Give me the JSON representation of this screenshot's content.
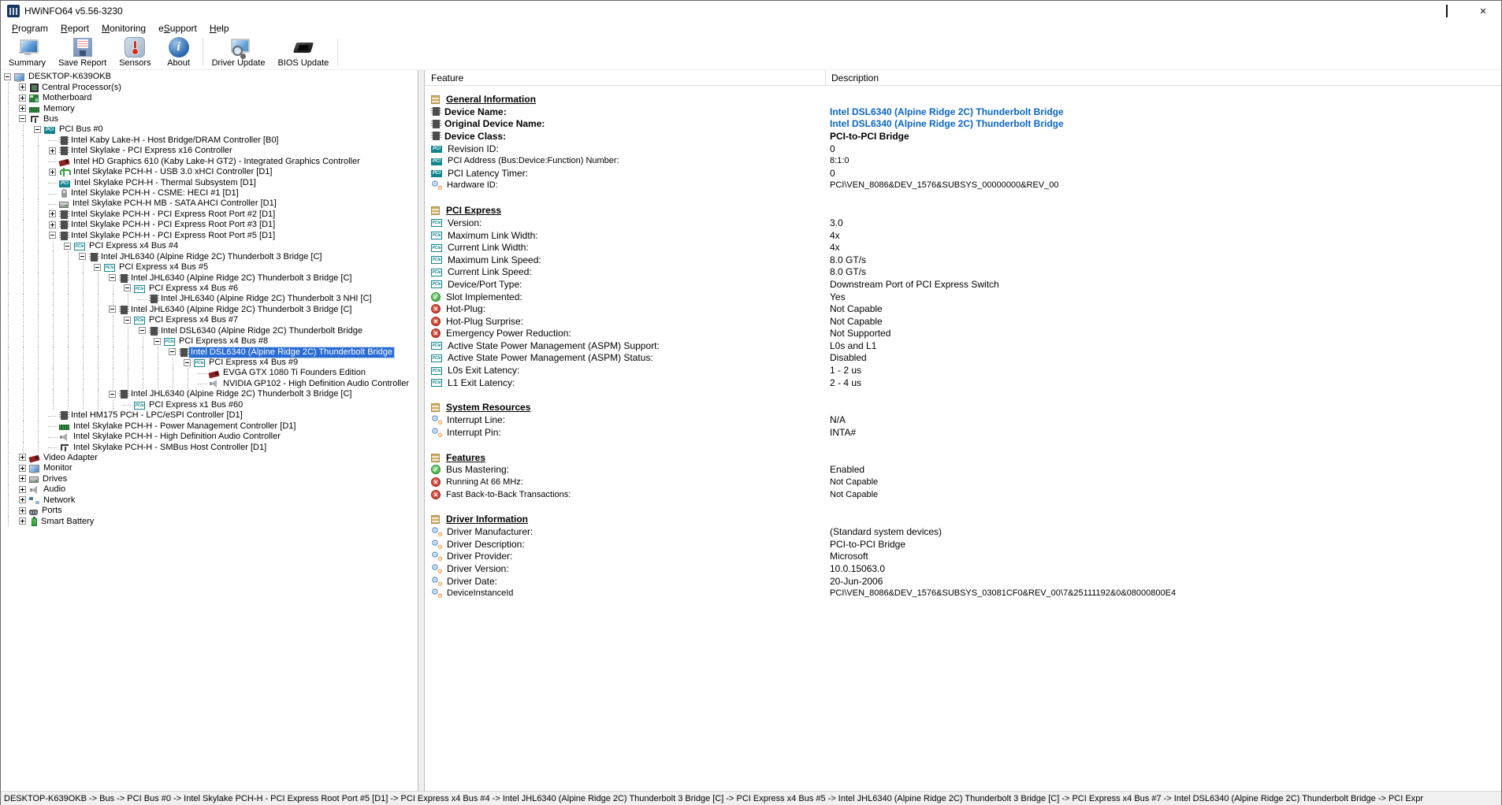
{
  "window": {
    "title": "HWiNFO64 v5.56-3230",
    "app_icon": "hwinfo-logo-icon",
    "controls": [
      {
        "id": "minimize",
        "icon": "minimize-icon"
      },
      {
        "id": "maximize",
        "icon": "maximize-icon"
      },
      {
        "id": "close",
        "icon": "close-icon"
      }
    ]
  },
  "menu": {
    "items": [
      {
        "label": "Program",
        "u": 0
      },
      {
        "label": "Report",
        "u": 0
      },
      {
        "label": "Monitoring",
        "u": 0
      },
      {
        "label": "eSupport",
        "u": 1
      },
      {
        "label": "Help",
        "u": 0
      }
    ]
  },
  "toolbar": {
    "buttons": [
      {
        "id": "summary",
        "label": "Summary",
        "icon": "summary-icon"
      },
      {
        "id": "save",
        "label": "Save Report",
        "icon": "save-report-icon"
      },
      {
        "id": "sensors",
        "label": "Sensors",
        "icon": "sensors-icon"
      },
      {
        "id": "about",
        "label": "About",
        "icon": "about-icon"
      },
      {
        "type": "separator"
      },
      {
        "id": "driver",
        "label": "Driver Update",
        "icon": "driver-update-icon"
      },
      {
        "id": "bios",
        "label": "BIOS Update",
        "icon": "bios-update-icon"
      },
      {
        "type": "separator"
      }
    ]
  },
  "tree": {
    "items": [
      {
        "level": 0,
        "expander": "minus",
        "icon": "computer-icon",
        "label": "DESKTOP-K639OKB"
      },
      {
        "level": 1,
        "expander": "plus",
        "icon": "cpu-icon",
        "label": "Central Processor(s)"
      },
      {
        "level": 1,
        "expander": "plus",
        "icon": "motherboard-icon",
        "label": "Motherboard"
      },
      {
        "level": 1,
        "expander": "plus",
        "icon": "memory-icon",
        "label": "Memory"
      },
      {
        "level": 1,
        "expander": "minus",
        "icon": "bus-icon",
        "label": "Bus"
      },
      {
        "level": 2,
        "expander": "minus",
        "icon": "pci-icon",
        "label": "PCI Bus #0"
      },
      {
        "level": 3,
        "expander": null,
        "icon": "chip-icon",
        "label": "Intel Kaby Lake-H - Host Bridge/DRAM Controller [B0]"
      },
      {
        "level": 3,
        "expander": "plus",
        "icon": "chip-icon",
        "label": "Intel Skylake - PCI Express x16 Controller"
      },
      {
        "level": 3,
        "expander": null,
        "icon": "gpu-icon",
        "label": "Intel HD Graphics 610 (Kaby Lake-H GT2) - Integrated Graphics Controller"
      },
      {
        "level": 3,
        "expander": "plus",
        "icon": "usb-icon",
        "label": "Intel Skylake PCH-H - USB 3.0 xHCI Controller [D1]"
      },
      {
        "level": 3,
        "expander": null,
        "icon": "pci-icon",
        "label": "Intel Skylake PCH-H - Thermal Subsystem [D1]"
      },
      {
        "level": 3,
        "expander": null,
        "icon": "device-icon",
        "label": "Intel Skylake PCH-H - CSME: HECI #1 [D1]"
      },
      {
        "level": 3,
        "expander": null,
        "icon": "drive-icon",
        "label": "Intel Skylake PCH-H MB - SATA AHCI Controller [D1]"
      },
      {
        "level": 3,
        "expander": "plus",
        "icon": "chip-icon",
        "label": "Intel Skylake PCH-H - PCI Express Root Port #2 [D1]"
      },
      {
        "level": 3,
        "expander": "plus",
        "icon": "chip-icon",
        "label": "Intel Skylake PCH-H - PCI Express Root Port #3 [D1]"
      },
      {
        "level": 3,
        "expander": "minus",
        "icon": "chip-icon",
        "label": "Intel Skylake PCH-H - PCI Express Root Port #5 [D1]"
      },
      {
        "level": 4,
        "expander": "minus",
        "icon": "pcie-icon",
        "label": "PCI Express x4 Bus #4"
      },
      {
        "level": 5,
        "expander": "minus",
        "icon": "chip-icon",
        "label": "Intel JHL6340 (Alpine Ridge 2C) Thunderbolt 3 Bridge [C]"
      },
      {
        "level": 6,
        "expander": "minus",
        "icon": "pcie-icon",
        "label": "PCI Express x4 Bus #5"
      },
      {
        "level": 7,
        "expander": "minus",
        "icon": "chip-icon",
        "label": "Intel JHL6340 (Alpine Ridge 2C) Thunderbolt 3 Bridge [C]"
      },
      {
        "level": 8,
        "expander": "minus",
        "icon": "pcie-icon",
        "label": "PCI Express x4 Bus #6"
      },
      {
        "level": 9,
        "expander": null,
        "icon": "chip-icon",
        "label": "Intel JHL6340 (Alpine Ridge 2C) Thunderbolt 3 NHI [C]"
      },
      {
        "level": 7,
        "expander": "minus",
        "icon": "chip-icon",
        "label": "Intel JHL6340 (Alpine Ridge 2C) Thunderbolt 3 Bridge [C]"
      },
      {
        "level": 8,
        "expander": "minus",
        "icon": "pcie-icon",
        "label": "PCI Express x4 Bus #7"
      },
      {
        "level": 9,
        "expander": "minus",
        "icon": "chip-icon",
        "label": "Intel DSL6340 (Alpine Ridge 2C) Thunderbolt Bridge"
      },
      {
        "level": 10,
        "expander": "minus",
        "icon": "pcie-icon",
        "label": "PCI Express x4 Bus #8"
      },
      {
        "level": 11,
        "expander": "minus",
        "icon": "chip-icon",
        "label": "Intel DSL6340 (Alpine Ridge 2C) Thunderbolt Bridge",
        "selected": true
      },
      {
        "level": 12,
        "expander": "minus",
        "icon": "pcie-icon",
        "label": "PCI Express x4 Bus #9"
      },
      {
        "level": 13,
        "expander": null,
        "icon": "gpu-icon",
        "label": "EVGA GTX 1080 Ti Founders Edition"
      },
      {
        "level": 13,
        "expander": null,
        "icon": "speaker-icon",
        "label": "NVIDIA GP102 - High Definition Audio Controller"
      },
      {
        "level": 7,
        "expander": "minus",
        "icon": "chip-icon",
        "label": "Intel JHL6340 (Alpine Ridge 2C) Thunderbolt 3 Bridge [C]"
      },
      {
        "level": 8,
        "expander": null,
        "icon": "pcie-icon",
        "label": "PCI Express x1 Bus #60"
      },
      {
        "level": 3,
        "expander": null,
        "icon": "chip-icon",
        "label": "Intel HM175 PCH - LPC/eSPI Controller [D1]"
      },
      {
        "level": 3,
        "expander": null,
        "icon": "memory-icon",
        "label": "Intel Skylake PCH-H - Power Management Controller [D1]"
      },
      {
        "level": 3,
        "expander": null,
        "icon": "speaker-icon",
        "label": "Intel Skylake PCH-H - High Definition Audio Controller"
      },
      {
        "level": 3,
        "expander": null,
        "icon": "bus-icon",
        "label": "Intel Skylake PCH-H - SMBus Host Controller [D1]"
      },
      {
        "level": 1,
        "expander": "plus",
        "icon": "gpu-icon",
        "label": "Video Adapter"
      },
      {
        "level": 1,
        "expander": "plus",
        "icon": "monitor-icon",
        "label": "Monitor"
      },
      {
        "level": 1,
        "expander": "plus",
        "icon": "drive-icon",
        "label": "Drives"
      },
      {
        "level": 1,
        "expander": "plus",
        "icon": "speaker-icon",
        "label": "Audio"
      },
      {
        "level": 1,
        "expander": "plus",
        "icon": "network-icon",
        "label": "Network"
      },
      {
        "level": 1,
        "expander": "plus",
        "icon": "ports-icon",
        "label": "Ports"
      },
      {
        "level": 1,
        "expander": "plus",
        "icon": "battery-icon",
        "label": "Smart Battery"
      }
    ]
  },
  "details": {
    "feature_header": "Feature",
    "description_header": "Description",
    "sections": [
      {
        "title": "General Information",
        "icon": "section-icon",
        "rows": [
          {
            "icon": "chip-icon",
            "label": "Device Name:",
            "emph": true,
            "value": "Intel DSL6340 (Alpine Ridge 2C) Thunderbolt Bridge",
            "vs": "link"
          },
          {
            "icon": "chip-icon",
            "label": "Original Device Name:",
            "emph": true,
            "value": "Intel DSL6340 (Alpine Ridge 2C) Thunderbolt Bridge",
            "vs": "link"
          },
          {
            "icon": "chip-icon",
            "label": "Device Class:",
            "emph": true,
            "value": "PCI-to-PCI Bridge",
            "vs": "bold"
          },
          {
            "icon": "pci-icon",
            "label": "Revision ID:",
            "value": "0"
          },
          {
            "icon": "pci-icon",
            "label": "PCI Address (Bus:Device:Function) Number:",
            "value": "8:1:0",
            "sm": true
          },
          {
            "icon": "pci-icon",
            "label": "PCI Latency Timer:",
            "value": "0"
          },
          {
            "icon": "gear-icon",
            "label": "Hardware ID:",
            "value": "PCI\\VEN_8086&DEV_1576&SUBSYS_00000000&REV_00",
            "sm": true
          }
        ]
      },
      {
        "title": "PCI Express",
        "icon": "section-icon",
        "rows": [
          {
            "icon": "pcie-icon",
            "label": "Version:",
            "value": "3.0"
          },
          {
            "icon": "pcie-icon",
            "label": "Maximum Link Width:",
            "value": "4x"
          },
          {
            "icon": "pcie-icon",
            "label": "Current Link Width:",
            "value": "4x"
          },
          {
            "icon": "pcie-icon",
            "label": "Maximum Link Speed:",
            "value": "8.0 GT/s"
          },
          {
            "icon": "pcie-icon",
            "label": "Current Link Speed:",
            "value": "8.0 GT/s"
          },
          {
            "icon": "pcie-icon",
            "label": "Device/Port Type:",
            "value": "Downstream Port of PCI Express Switch"
          },
          {
            "icon": "check-icon",
            "label": "Slot Implemented:",
            "value": "Yes"
          },
          {
            "icon": "cross-icon",
            "label": "Hot-Plug:",
            "value": "Not Capable"
          },
          {
            "icon": "cross-icon",
            "label": "Hot-Plug Surprise:",
            "value": "Not Capable"
          },
          {
            "icon": "cross-icon",
            "label": "Emergency Power Reduction:",
            "value": "Not Supported"
          },
          {
            "icon": "pcie-icon",
            "label": "Active State Power Management (ASPM) Support:",
            "value": "L0s and L1"
          },
          {
            "icon": "pcie-icon",
            "label": "Active State Power Management (ASPM) Status:",
            "value": "Disabled"
          },
          {
            "icon": "pcie-icon",
            "label": "L0s Exit Latency:",
            "value": "1 - 2 us"
          },
          {
            "icon": "pcie-icon",
            "label": "L1 Exit Latency:",
            "value": "2 - 4 us"
          }
        ]
      },
      {
        "title": "System Resources",
        "icon": "section-icon",
        "rows": [
          {
            "icon": "gear-icon",
            "label": "Interrupt Line:",
            "value": "N/A"
          },
          {
            "icon": "gear-icon",
            "label": "Interrupt Pin:",
            "value": "INTA#"
          }
        ]
      },
      {
        "title": "Features",
        "icon": "section-icon",
        "rows": [
          {
            "icon": "check-icon",
            "label": "Bus Mastering:",
            "value": "Enabled"
          },
          {
            "icon": "cross-icon",
            "label": "Running At 66 MHz:",
            "value": "Not Capable",
            "sm": true
          },
          {
            "icon": "cross-icon",
            "label": "Fast Back-to-Back Transactions:",
            "value": "Not Capable",
            "sm": true
          }
        ]
      },
      {
        "title": "Driver Information",
        "icon": "section-icon",
        "rows": [
          {
            "icon": "gear-icon",
            "label": "Driver Manufacturer:",
            "value": "(Standard system devices)"
          },
          {
            "icon": "gear-icon",
            "label": "Driver Description:",
            "value": "PCI-to-PCI Bridge"
          },
          {
            "icon": "gear-icon",
            "label": "Driver Provider:",
            "value": "Microsoft"
          },
          {
            "icon": "gear-icon",
            "label": "Driver Version:",
            "value": "10.0.15063.0"
          },
          {
            "icon": "gear-icon",
            "label": "Driver Date:",
            "value": "20-Jun-2006"
          },
          {
            "icon": "gear-icon",
            "label": "DeviceInstanceId",
            "value": "PCI\\VEN_8086&DEV_1576&SUBSYS_03081CF0&REV_00\\7&25111192&0&08000800E4",
            "sm": true
          }
        ]
      }
    ]
  },
  "statusbar": {
    "path": "DESKTOP-K639OKB -> Bus -> PCI Bus #0 -> Intel Skylake PCH-H - PCI Express Root Port #5 [D1] -> PCI Express x4 Bus #4 -> Intel JHL6340 (Alpine Ridge 2C) Thunderbolt 3 Bridge [C] -> PCI Express x4 Bus #5 -> Intel JHL6340 (Alpine Ridge 2C) Thunderbolt 3 Bridge [C] -> PCI Express x4 Bus #7 -> Intel DSL6340 (Alpine Ridge 2C) Thunderbolt Bridge -> PCI Expr"
  }
}
